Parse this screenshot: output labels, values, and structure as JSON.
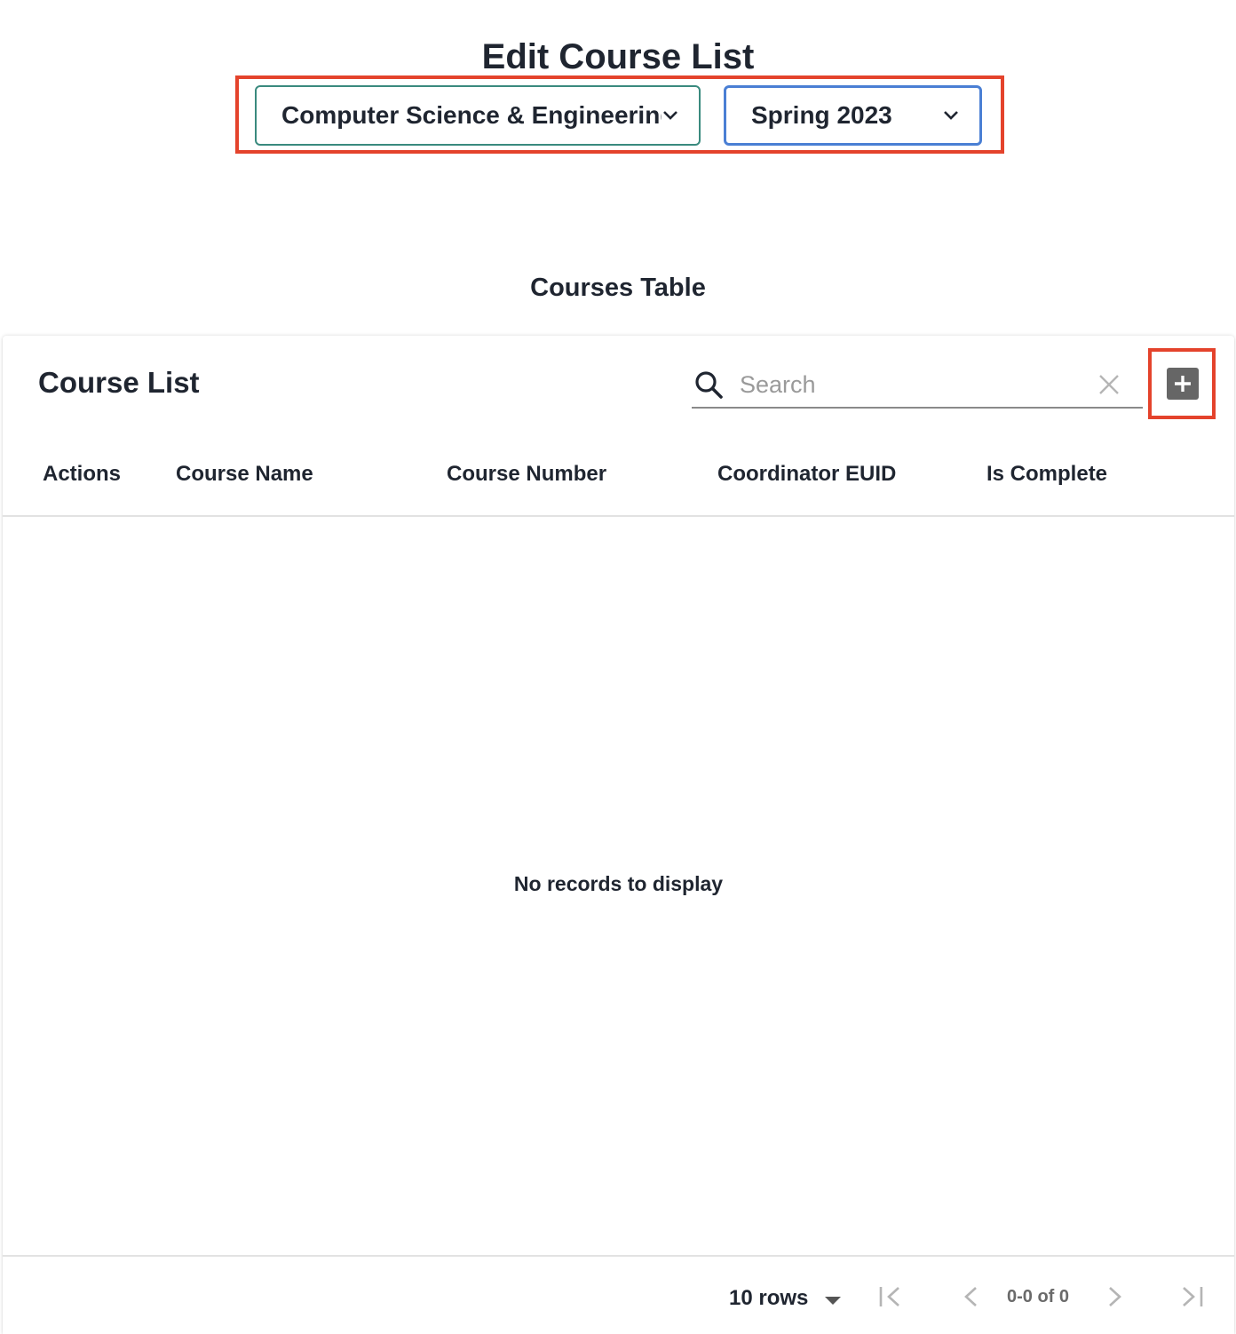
{
  "page": {
    "title": "Edit Course List",
    "department_select": {
      "value": "Computer Science & Engineering",
      "icon": "chevron-down-icon"
    },
    "term_select": {
      "value": "Spring 2023",
      "icon": "chevron-down-icon"
    },
    "section_title": "Courses Table"
  },
  "table": {
    "title": "Course List",
    "search": {
      "placeholder": "Search",
      "value": ""
    },
    "add_button_icon": "plus-icon",
    "columns": [
      "Actions",
      "Course Name",
      "Course Number",
      "Coordinator EUID",
      "Is Complete"
    ],
    "rows": [],
    "empty_message": "No records to display"
  },
  "pagination": {
    "rows_per_page": "10 rows",
    "range": "0-0 of 0"
  },
  "colors": {
    "highlight": "#e4432c",
    "department_border": "#3a8a7e",
    "term_border": "#4a7fd4",
    "add_button": "#666666"
  }
}
